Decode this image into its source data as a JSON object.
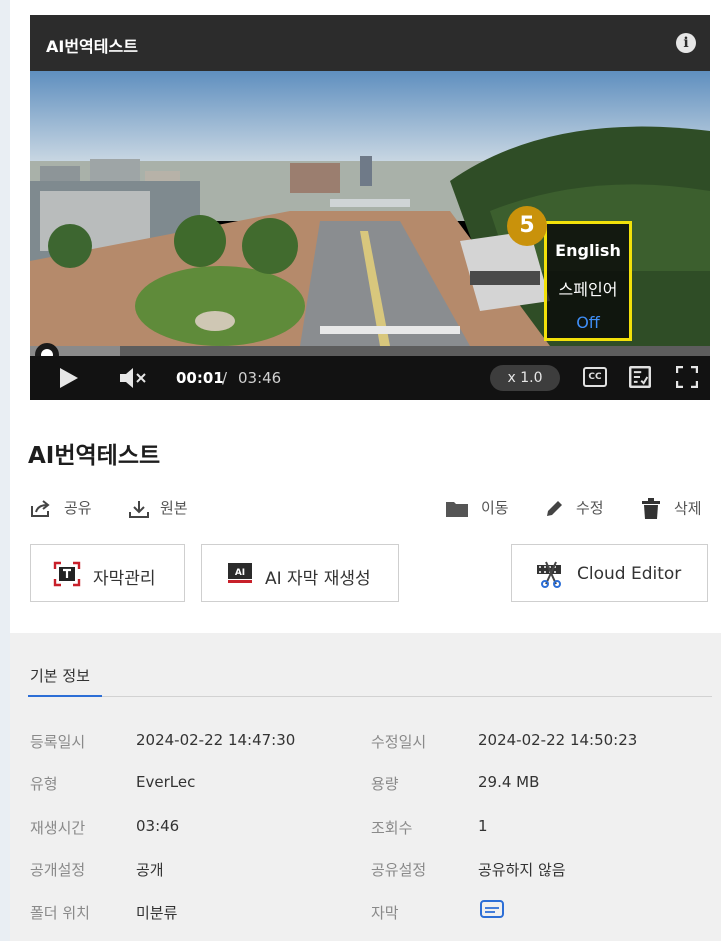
{
  "player": {
    "title": "AI번역테스트",
    "time_current": "00:01",
    "time_separator": "/",
    "time_total": "03:46",
    "speed": "x 1.0",
    "cc_label": "CC",
    "progress_fraction": 0.003,
    "step_badge": "5",
    "subtitle_options": [
      "English",
      "스페인어",
      "Off"
    ],
    "highlight_color": "#f2e10a",
    "off_color": "#3f8ef6"
  },
  "video": {
    "title": "AI번역테스트"
  },
  "actions": {
    "share": "공유",
    "original": "원본",
    "move": "이동",
    "edit": "수정",
    "delete": "삭제"
  },
  "buttons": {
    "subtitle_manage": "자막관리",
    "ai_regen": "AI 자막 재생성",
    "cloud_editor": "Cloud Editor"
  },
  "info": {
    "tab": "기본 정보",
    "rows": [
      {
        "label": "등록일시",
        "value": "2024-02-22 14:47:30",
        "label2": "수정일시",
        "value2": "2024-02-22 14:50:23"
      },
      {
        "label": "유형",
        "value": "EverLec",
        "label2": "용량",
        "value2": "29.4 MB"
      },
      {
        "label": "재생시간",
        "value": "03:46",
        "label2": "조회수",
        "value2": "1"
      },
      {
        "label": "공개설정",
        "value": "공개",
        "label2": "공유설정",
        "value2": "공유하지 않음"
      },
      {
        "label": "폴더 위치",
        "value": "미분류",
        "label2": "자막",
        "value2": ""
      }
    ],
    "accent_color": "#2c6ed6"
  }
}
